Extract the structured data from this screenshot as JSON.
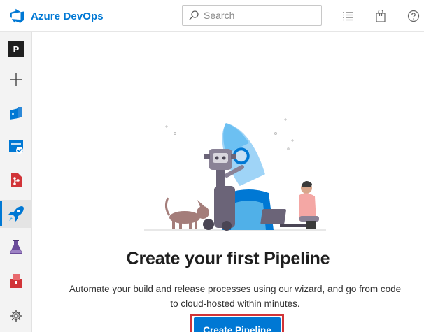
{
  "header": {
    "app_name": "Azure DevOps",
    "search_placeholder": "Search",
    "icons": [
      "azure-devops-logo-icon",
      "search-icon",
      "task-list-icon",
      "shopping-bag-icon",
      "help-icon"
    ]
  },
  "sidebar": {
    "project_initial": "P",
    "items": [
      {
        "name": "project",
        "icon": "project-avatar"
      },
      {
        "name": "new",
        "icon": "plus-icon"
      },
      {
        "name": "boards",
        "icon": "boards-icon"
      },
      {
        "name": "repos-tasks",
        "icon": "board-check-icon"
      },
      {
        "name": "repos",
        "icon": "repos-icon"
      },
      {
        "name": "pipelines",
        "icon": "pipelines-icon",
        "active": true
      },
      {
        "name": "test-plans",
        "icon": "test-flask-icon"
      },
      {
        "name": "artifacts",
        "icon": "artifacts-icon"
      },
      {
        "name": "settings",
        "icon": "gear-icon"
      }
    ]
  },
  "main": {
    "title": "Create your first Pipeline",
    "description": "Automate your build and release processes using our wizard, and go from code to cloud-hosted within minutes.",
    "cta_label": "Create Pipeline"
  },
  "colors": {
    "accent": "#0078d4",
    "highlight_border": "#d13438",
    "sidebar_bg": "#f3f3f3"
  }
}
